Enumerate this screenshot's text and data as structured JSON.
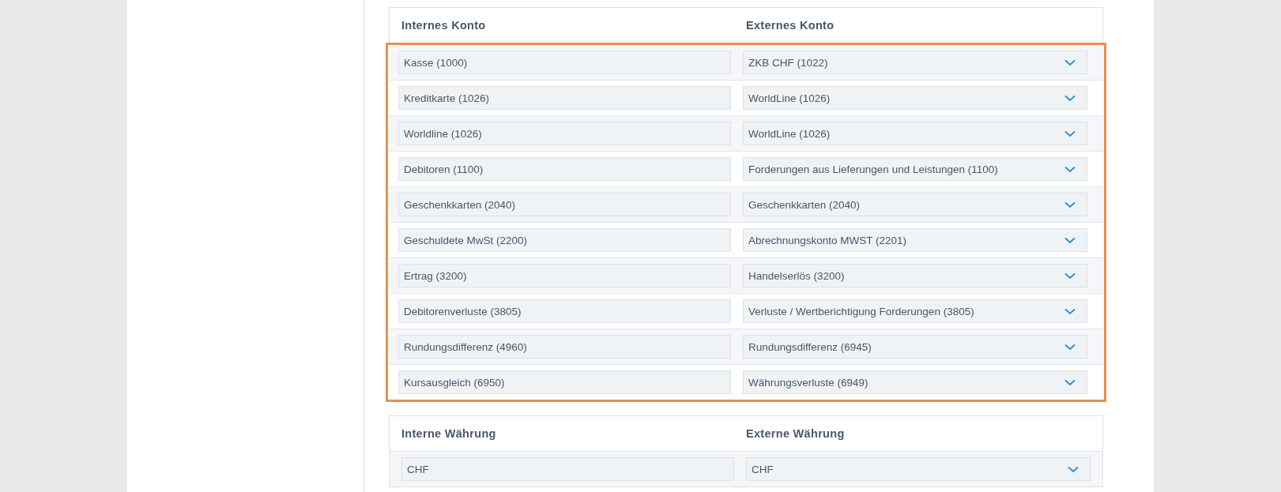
{
  "mapping_tables": [
    {
      "columns": [
        "Internes Konto",
        "Externes Konto"
      ],
      "highlighted": true,
      "rows": [
        {
          "internal": "Kasse (1000)",
          "external": "ZKB CHF (1022)"
        },
        {
          "internal": "Kreditkarte (1026)",
          "external": "WorldLine (1026)"
        },
        {
          "internal": "Worldline (1026)",
          "external": "WorldLine (1026)"
        },
        {
          "internal": "Debitoren (1100)",
          "external": "Forderungen aus Lieferungen und Leistungen (1100)"
        },
        {
          "internal": "Geschenkkarten (2040)",
          "external": "Geschenkkarten (2040)"
        },
        {
          "internal": "Geschuldete MwSt (2200)",
          "external": "Abrechnungskonto MWST (2201)"
        },
        {
          "internal": "Ertrag (3200)",
          "external": "Handelserlös (3200)"
        },
        {
          "internal": "Debitorenverluste (3805)",
          "external": "Verluste / Wertberichtigung Forderungen (3805)"
        },
        {
          "internal": "Rundungsdifferenz (4960)",
          "external": "Rundungsdifferenz (6945)"
        },
        {
          "internal": "Kursausgleich (6950)",
          "external": "Währungsverluste (6949)"
        }
      ]
    },
    {
      "columns": [
        "Interne Währung",
        "Externe Währung"
      ],
      "highlighted": false,
      "rows": [
        {
          "internal": "CHF",
          "external": "CHF"
        }
      ]
    }
  ]
}
